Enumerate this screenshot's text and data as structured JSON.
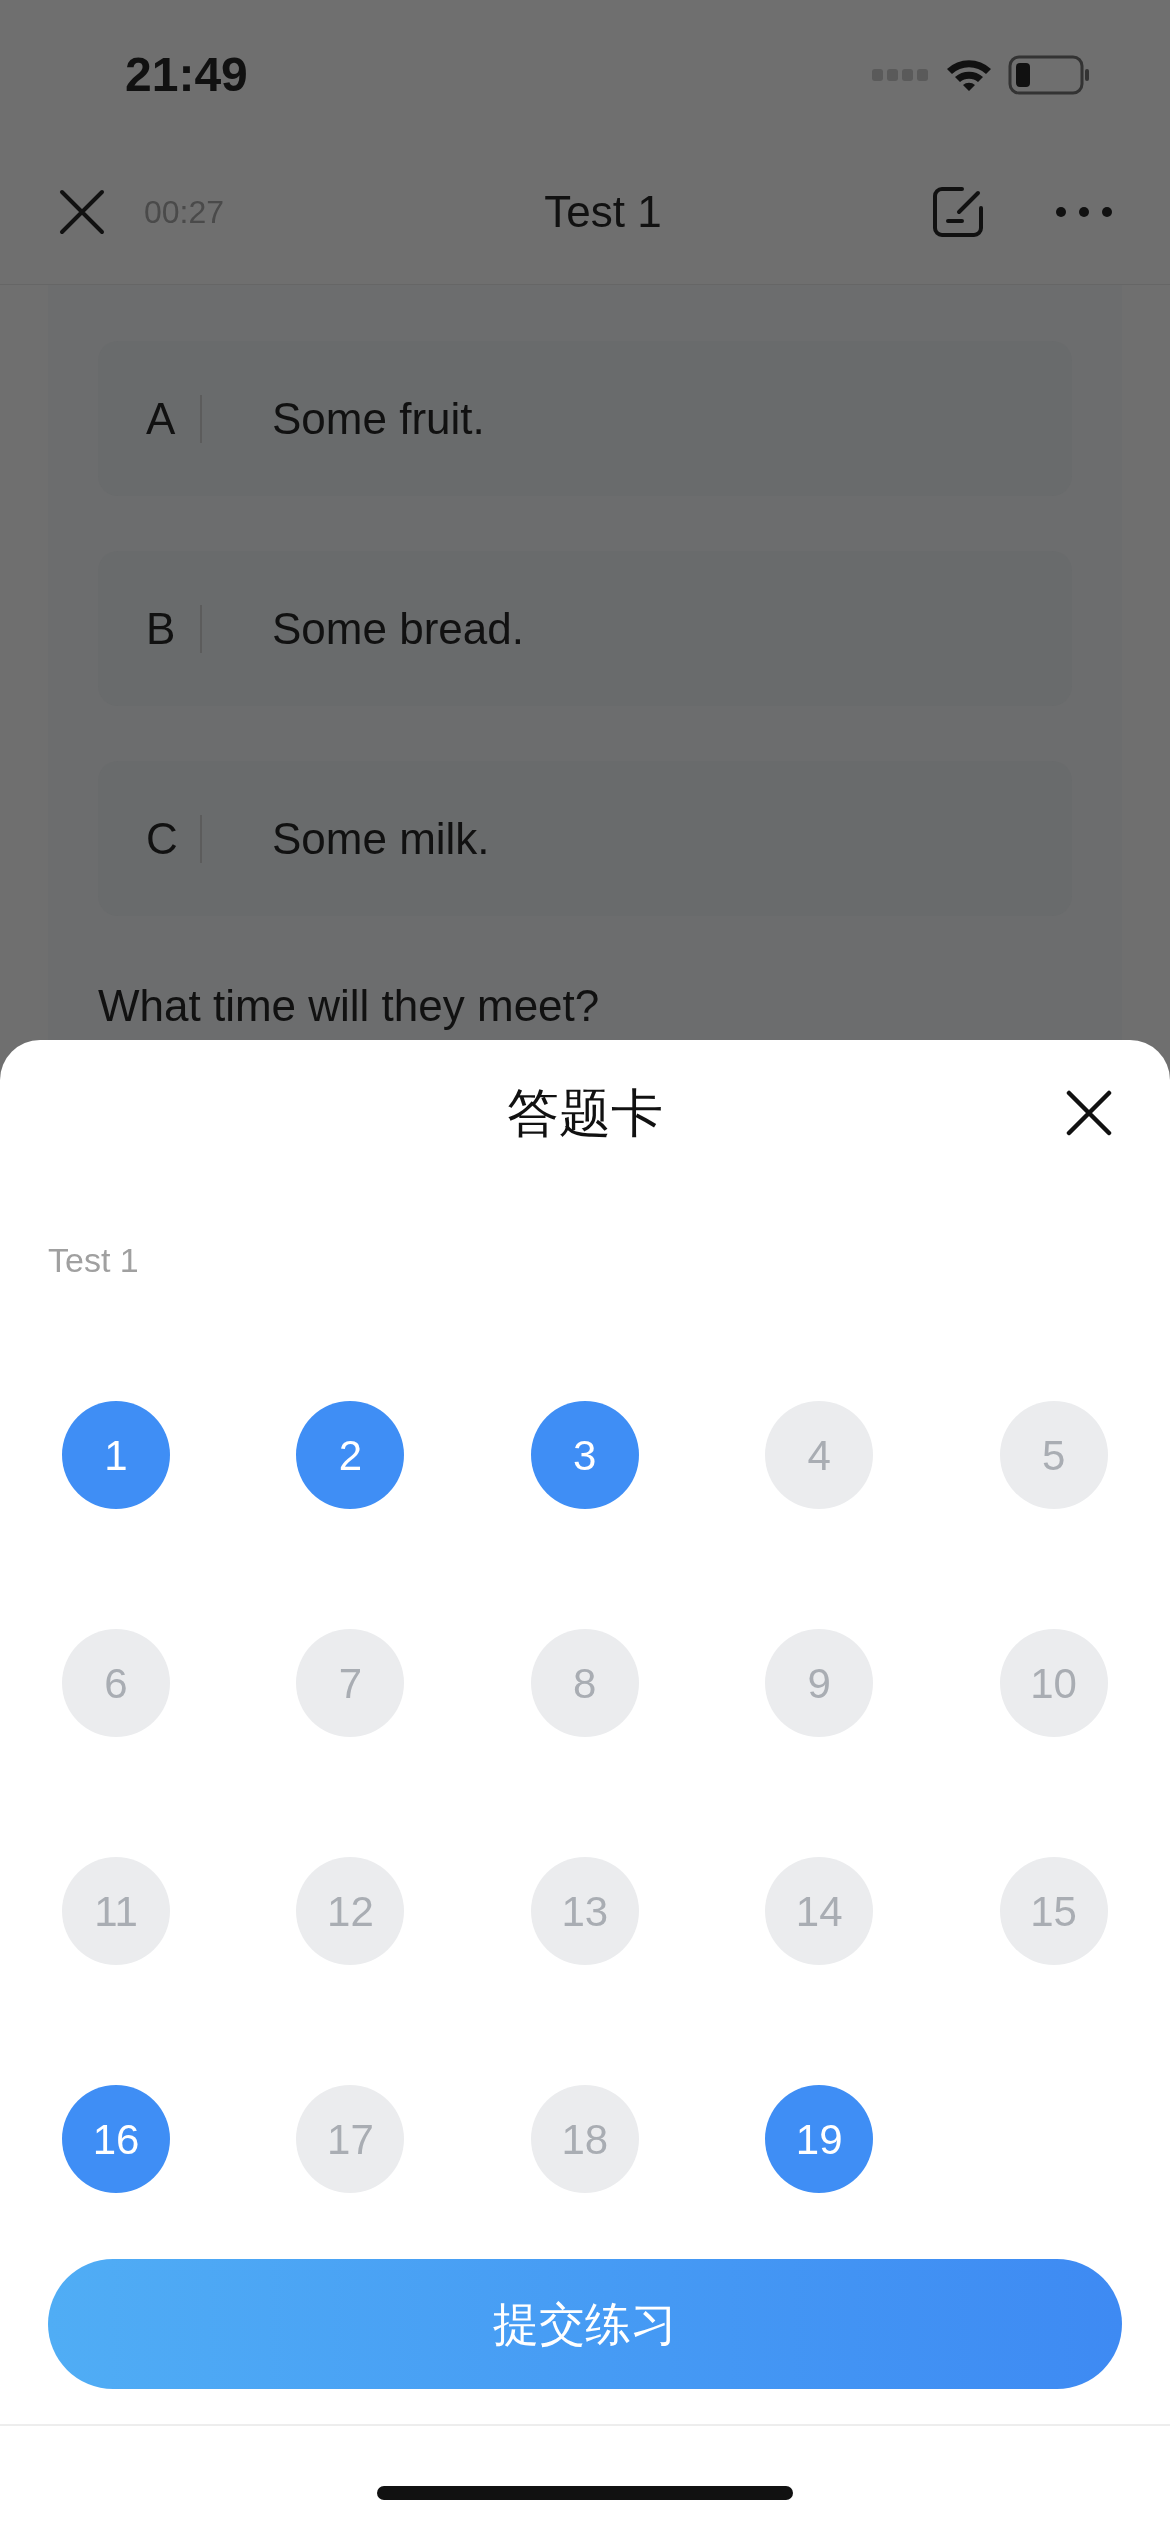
{
  "status_bar": {
    "time": "21:49"
  },
  "nav_bar": {
    "timer": "00:27",
    "title": "Test 1"
  },
  "options": [
    {
      "letter": "A",
      "text": "Some fruit."
    },
    {
      "letter": "B",
      "text": "Some bread."
    },
    {
      "letter": "C",
      "text": "Some milk."
    }
  ],
  "next_question": "What time will they meet?",
  "answer_sheet": {
    "title": "答题卡",
    "section": "Test 1",
    "questions": [
      {
        "number": "1",
        "answered": true
      },
      {
        "number": "2",
        "answered": true
      },
      {
        "number": "3",
        "answered": true
      },
      {
        "number": "4",
        "answered": false
      },
      {
        "number": "5",
        "answered": false
      },
      {
        "number": "6",
        "answered": false
      },
      {
        "number": "7",
        "answered": false
      },
      {
        "number": "8",
        "answered": false
      },
      {
        "number": "9",
        "answered": false
      },
      {
        "number": "10",
        "answered": false
      },
      {
        "number": "11",
        "answered": false
      },
      {
        "number": "12",
        "answered": false
      },
      {
        "number": "13",
        "answered": false
      },
      {
        "number": "14",
        "answered": false
      },
      {
        "number": "15",
        "answered": false
      },
      {
        "number": "16",
        "answered": true
      },
      {
        "number": "17",
        "answered": false
      },
      {
        "number": "18",
        "answered": false
      },
      {
        "number": "19",
        "answered": true
      }
    ],
    "submit": "提交练习"
  }
}
